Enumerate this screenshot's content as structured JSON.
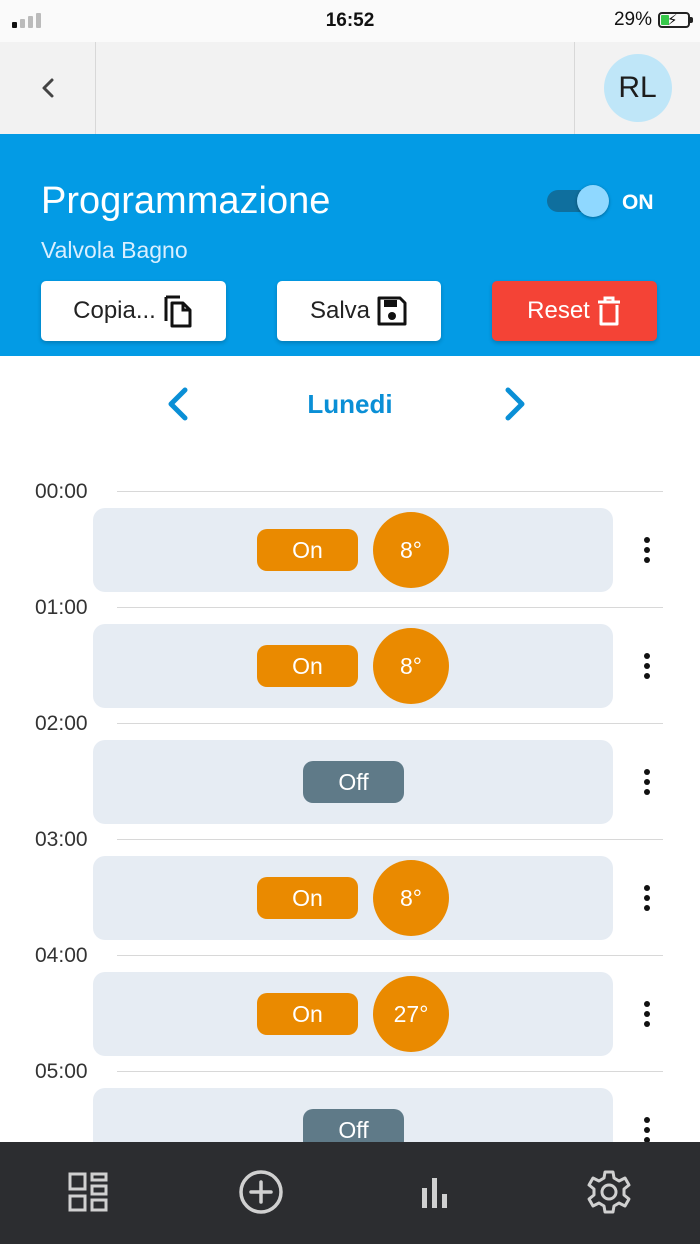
{
  "status_bar": {
    "time": "16:52",
    "battery_percent": "29%",
    "battery_level": 0.29,
    "charging": true,
    "signal_bars": 1
  },
  "header": {
    "back_icon": "chevron-left-icon",
    "avatar_initials": "RL"
  },
  "panel": {
    "title": "Programmazione",
    "subtitle": "Valvola Bagno",
    "toggle_label": "ON",
    "toggle_on": true,
    "buttons": {
      "copy": "Copia...",
      "save": "Salva",
      "reset": "Reset"
    },
    "colors": {
      "panel_bg": "#039be5",
      "reset_bg": "#f44336"
    }
  },
  "day_nav": {
    "day": "Lunedi",
    "prev_icon": "chevron-left-icon",
    "next_icon": "chevron-right-icon"
  },
  "schedule": {
    "slots": [
      {
        "hour": "00:00",
        "state": "On",
        "temp": "8°"
      },
      {
        "hour": "01:00",
        "state": "On",
        "temp": "8°"
      },
      {
        "hour": "02:00",
        "state": "Off",
        "temp": ""
      },
      {
        "hour": "03:00",
        "state": "On",
        "temp": "8°"
      },
      {
        "hour": "04:00",
        "state": "On",
        "temp": "27°"
      },
      {
        "hour": "05:00",
        "state": "Off",
        "temp": ""
      }
    ],
    "colors": {
      "on": "#ea8a00",
      "off": "#5f7a88",
      "card": "#e6ecf3"
    }
  },
  "bottom_nav": {
    "items": [
      {
        "icon": "dashboard-icon"
      },
      {
        "icon": "add-circle-icon"
      },
      {
        "icon": "bar-chart-icon"
      },
      {
        "icon": "settings-gear-icon"
      }
    ]
  }
}
